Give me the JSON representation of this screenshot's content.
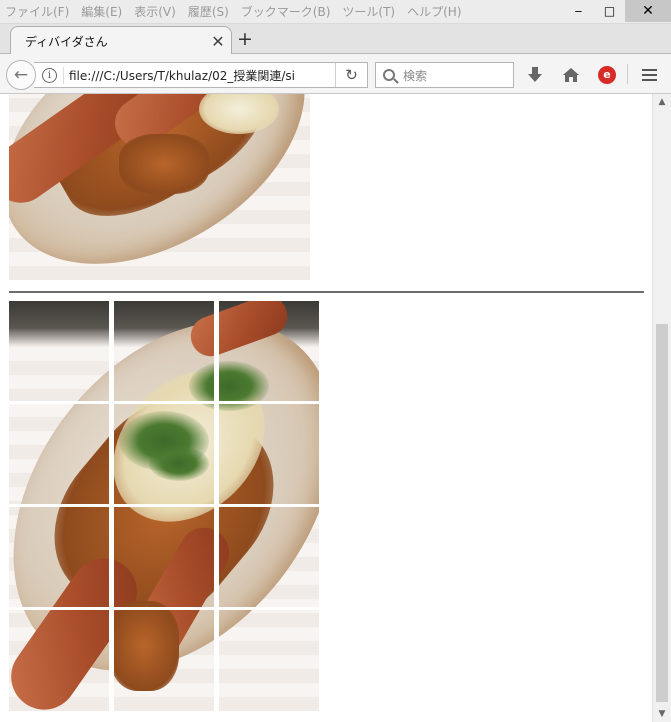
{
  "menubar": {
    "items": [
      "ファイル(F)",
      "編集(E)",
      "表示(V)",
      "履歴(S)",
      "ブックマーク(B)",
      "ツール(T)",
      "ヘルプ(H)"
    ]
  },
  "window": {
    "minimize": "‒",
    "maximize": "□",
    "close": "✕"
  },
  "tab": {
    "title": "ディバイダさん",
    "close": "✕",
    "new_tab": "+"
  },
  "navbar": {
    "url": "file:///C:/Users/T/khulaz/02_授業関連/si",
    "search_placeholder": "検索",
    "back": "←",
    "reload": "↻",
    "download": "⬇",
    "home": "⌂",
    "trend": "e",
    "info": "i"
  },
  "page": {
    "top_image_alt": "hotdog",
    "grid": {
      "rows": 4,
      "cols": 3,
      "tiles": [
        "tile-1",
        "tile-2",
        "tile-3",
        "tile-4",
        "tile-5",
        "tile-6",
        "tile-7",
        "tile-8",
        "tile-9",
        "tile-10",
        "tile-11",
        "tile-12"
      ]
    }
  },
  "colors": {
    "rule": "#6d6d6d",
    "trend_red": "#d62b26"
  }
}
